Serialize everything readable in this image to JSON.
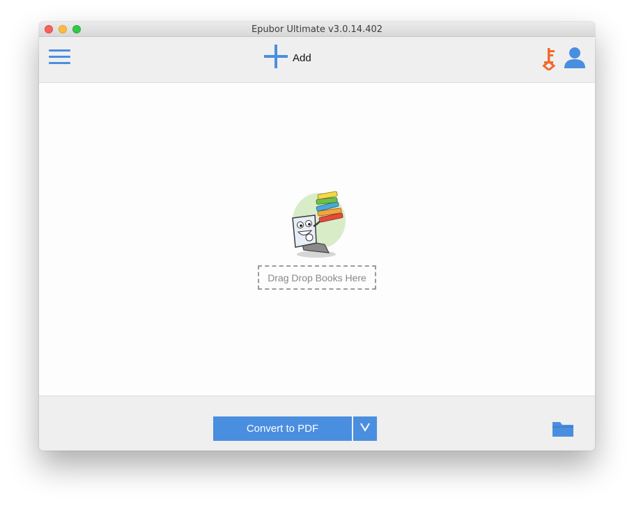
{
  "window": {
    "title": "Epubor Ultimate v3.0.14.402"
  },
  "toolbar": {
    "menu_icon": "hamburger-menu-icon",
    "add_label": "Add",
    "add_icon": "plus-icon",
    "key_icon": "key-icon",
    "user_icon": "user-icon"
  },
  "main": {
    "dropzone_label": "Drag Drop Books Here",
    "illustration": "laptop-books-mascot"
  },
  "footer": {
    "convert_label": "Convert to PDF",
    "dropdown_icon": "chevron-down-icon",
    "folder_icon": "folder-icon"
  },
  "colors": {
    "accent_blue": "#4a8ee0",
    "key_orange": "#f06a2a",
    "toolbar_bg": "#efefef",
    "content_bg": "#fdfdfd"
  }
}
